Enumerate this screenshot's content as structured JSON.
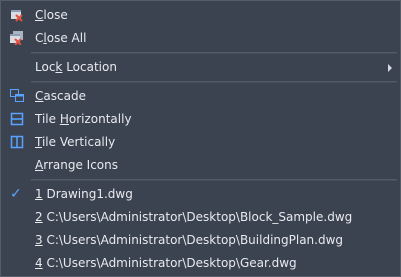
{
  "menu": {
    "items": [
      {
        "id": "close",
        "mnemonic": "C",
        "rest": "lose",
        "icon": "close-window-icon"
      },
      {
        "id": "close_all",
        "mnemonic": "",
        "rest": "",
        "pre": "C",
        "mid": "l",
        "post": "ose All",
        "icon": "close-all-windows-icon"
      },
      {
        "id": "lock_location",
        "pre": "Loc",
        "mid": "k",
        "post": " Location",
        "has_submenu": true
      },
      {
        "id": "cascade",
        "mnemonic": "C",
        "rest": "ascade",
        "icon": "cascade-windows-icon"
      },
      {
        "id": "tile_h",
        "pre": "Tile ",
        "mid": "H",
        "post": "orizontally",
        "icon": "tile-horizontal-icon"
      },
      {
        "id": "tile_v",
        "mnemonic": "T",
        "rest": "ile Vertically",
        "icon": "tile-vertical-icon"
      },
      {
        "id": "arrange",
        "mnemonic": "A",
        "rest": "rrange Icons"
      },
      {
        "id": "doc1",
        "num": "1",
        "text": " Drawing1.dwg",
        "checked": true,
        "check_icon": "checkmark-icon"
      },
      {
        "id": "doc2",
        "num": "2",
        "text": " C:\\Users\\Administrator\\Desktop\\Block_Sample.dwg"
      },
      {
        "id": "doc3",
        "num": "3",
        "text": " C:\\Users\\Administrator\\Desktop\\BuildingPlan.dwg"
      },
      {
        "id": "doc4",
        "num": "4",
        "text": " C:\\Users\\Administrator\\Desktop\\Gear.dwg"
      }
    ]
  },
  "colors": {
    "background": "#3b4350",
    "text": "#e8eaee",
    "check": "#5aa4ff",
    "icon_blue": "#5aa4ff",
    "icon_red": "#e05040"
  }
}
